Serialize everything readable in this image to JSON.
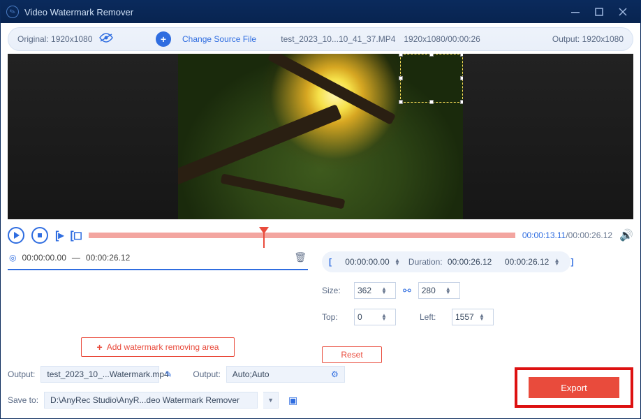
{
  "titlebar": {
    "title": "Video Watermark Remover"
  },
  "toolbar": {
    "original_label": "Original: 1920x1080",
    "change_source": "Change Source File",
    "filename": "test_2023_10...10_41_37.MP4",
    "src_meta": "1920x1080/00:00:26",
    "output_label": "Output: 1920x1080"
  },
  "playback": {
    "current_time": "00:00:13.11",
    "total_time": "00:00:26.12"
  },
  "segment": {
    "start": "00:00:00.00",
    "dash": "—",
    "end": "00:00:26.12"
  },
  "add_area_label": "Add watermark removing area",
  "trim": {
    "start": "00:00:00.00",
    "duration_label": "Duration:",
    "duration": "00:00:26.12",
    "end": "00:00:26.12"
  },
  "dims": {
    "size_label": "Size:",
    "w": "362",
    "h": "280",
    "top_label": "Top:",
    "top": "0",
    "left_label": "Left:",
    "left": "1557"
  },
  "reset_label": "Reset",
  "output": {
    "label": "Output:",
    "filename": "test_2023_10_...Watermark.mp4",
    "format_label": "Output:",
    "format_value": "Auto;Auto"
  },
  "save": {
    "label": "Save to:",
    "path": "D:\\AnyRec Studio\\AnyR...deo Watermark Remover"
  },
  "export_label": "Export"
}
